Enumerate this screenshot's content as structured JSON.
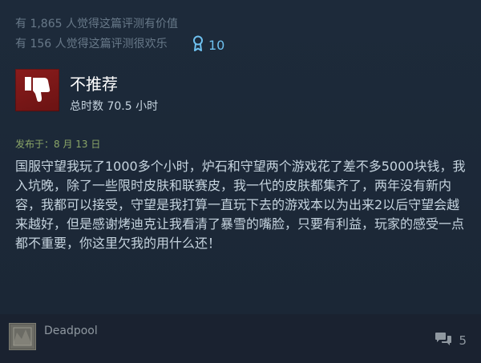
{
  "review": {
    "helpful_text": "有 1,865 人觉得这篇评测有价值",
    "funny_text": "有 156 人觉得这篇评测很欢乐",
    "award_icon": "award-ribbon-icon",
    "award_count": "10",
    "thumb_icon": "thumbs-down-icon",
    "verdict": "不推荐",
    "hours": "总时数 70.5 小时",
    "posted": "发布于：8 月 13 日",
    "body": "国服守望我玩了1000多个小时，炉石和守望两个游戏花了差不多5000块钱，我入坑晚，除了一些限时皮肤和联赛皮，我一代的皮肤都集齐了，两年没有新内容，我都可以接受，守望是我打算一直玩下去的游戏本以为出来2以后守望会越来越好，但是感谢烤迪克让我看清了暴雪的嘴脸，只要有利益，玩家的感受一点都不重要，你这里欠我的用什么还！"
  },
  "author": {
    "name": "Deadpool",
    "comment_icon": "comment-bubble-icon",
    "comment_count": "5"
  },
  "colors": {
    "background": "#1b2838",
    "negative": "#8a1c1c",
    "award": "#6ec1f0",
    "posted": "#8ba668"
  }
}
